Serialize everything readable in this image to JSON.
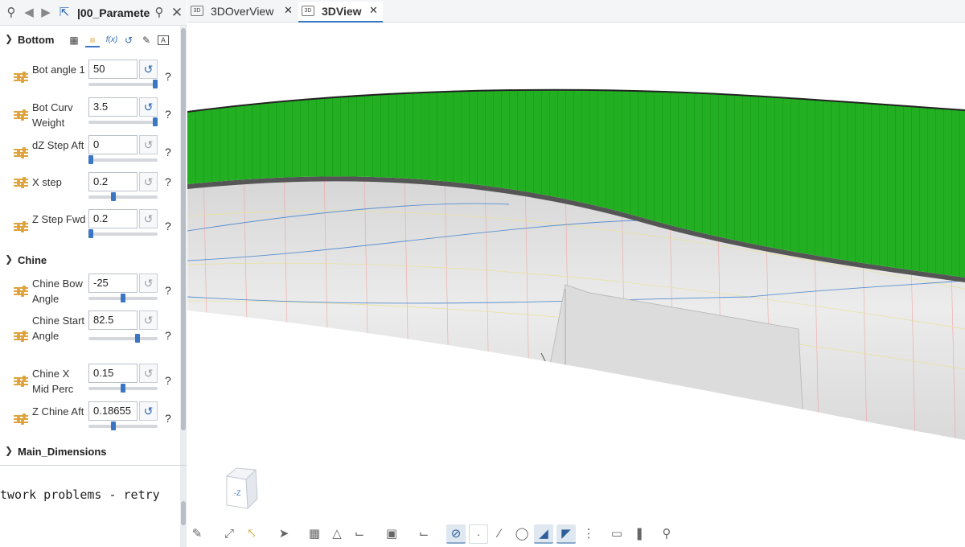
{
  "left_toolbar": {
    "doc_title": "|00_Paramete",
    "icons": [
      "pin-icon",
      "back-icon",
      "forward-icon",
      "select-icon",
      "search-icon",
      "close-icon"
    ]
  },
  "sections": {
    "bottom": {
      "title": "Bottom",
      "icons": [
        "table-icon",
        "sliders-icon",
        "function-icon",
        "undo-icon",
        "pencil-icon",
        "text-box-icon"
      ]
    },
    "chine": {
      "title": "Chine"
    },
    "main_dimensions": {
      "title": "Main_Dimensions"
    }
  },
  "params": [
    {
      "label": "Bot angle 1",
      "value": "50",
      "slider": 1.0,
      "reset_active": true
    },
    {
      "label": "Bot Curv Weight",
      "value": "3.5",
      "slider": 1.0,
      "reset_active": true
    },
    {
      "label": "dZ Step Aft",
      "value": "0",
      "slider": 0.0,
      "reset_active": false
    },
    {
      "label": "X step",
      "value": "0.2",
      "slider": 0.35,
      "reset_active": false
    },
    {
      "label": "Z Step Fwd",
      "value": "0.2",
      "slider": 0.0,
      "reset_active": false
    },
    {
      "label": "Chine Bow Angle",
      "value": "-25",
      "slider": 0.5,
      "reset_active": false
    },
    {
      "label": "Chine Start Angle",
      "value": "82.5",
      "slider": 0.73,
      "reset_active": false
    },
    {
      "label": "Chine X Mid Perc",
      "value": "0.15",
      "slider": 0.5,
      "reset_active": false
    },
    {
      "label": "Z Chine Aft",
      "value": "0.18655",
      "slider": 0.35,
      "reset_active": true
    }
  ],
  "help_symbol": "?",
  "console": {
    "text": "twork problems - retry"
  },
  "tabs": [
    {
      "label": "3DOverView",
      "badge": "3D",
      "active": false
    },
    {
      "label": "3DView",
      "badge": "3D",
      "active": true
    }
  ],
  "nav_cube": {
    "face_label": "-Z"
  },
  "colors": {
    "green_surface": "#22b022",
    "hull_grey": "#e3e3e3",
    "accent": "#3a76c4"
  },
  "bottom_toolbar": {
    "icons": [
      "pencil-icon",
      "fit-all-icon",
      "fit-selection-icon",
      "pointer-icon",
      "box-view-icon",
      "perspective-icon",
      "axes-icon",
      "camera-icon",
      "crop-icon",
      "hide-icon",
      "point-icon",
      "line-icon",
      "face-icon",
      "shaded-face-icon",
      "hatched-face-icon",
      "dots-icon",
      "page-icon",
      "stripes-icon",
      "zoom-icon"
    ],
    "active": [
      "hide-icon",
      "shaded-face-icon",
      "hatched-face-icon"
    ]
  }
}
